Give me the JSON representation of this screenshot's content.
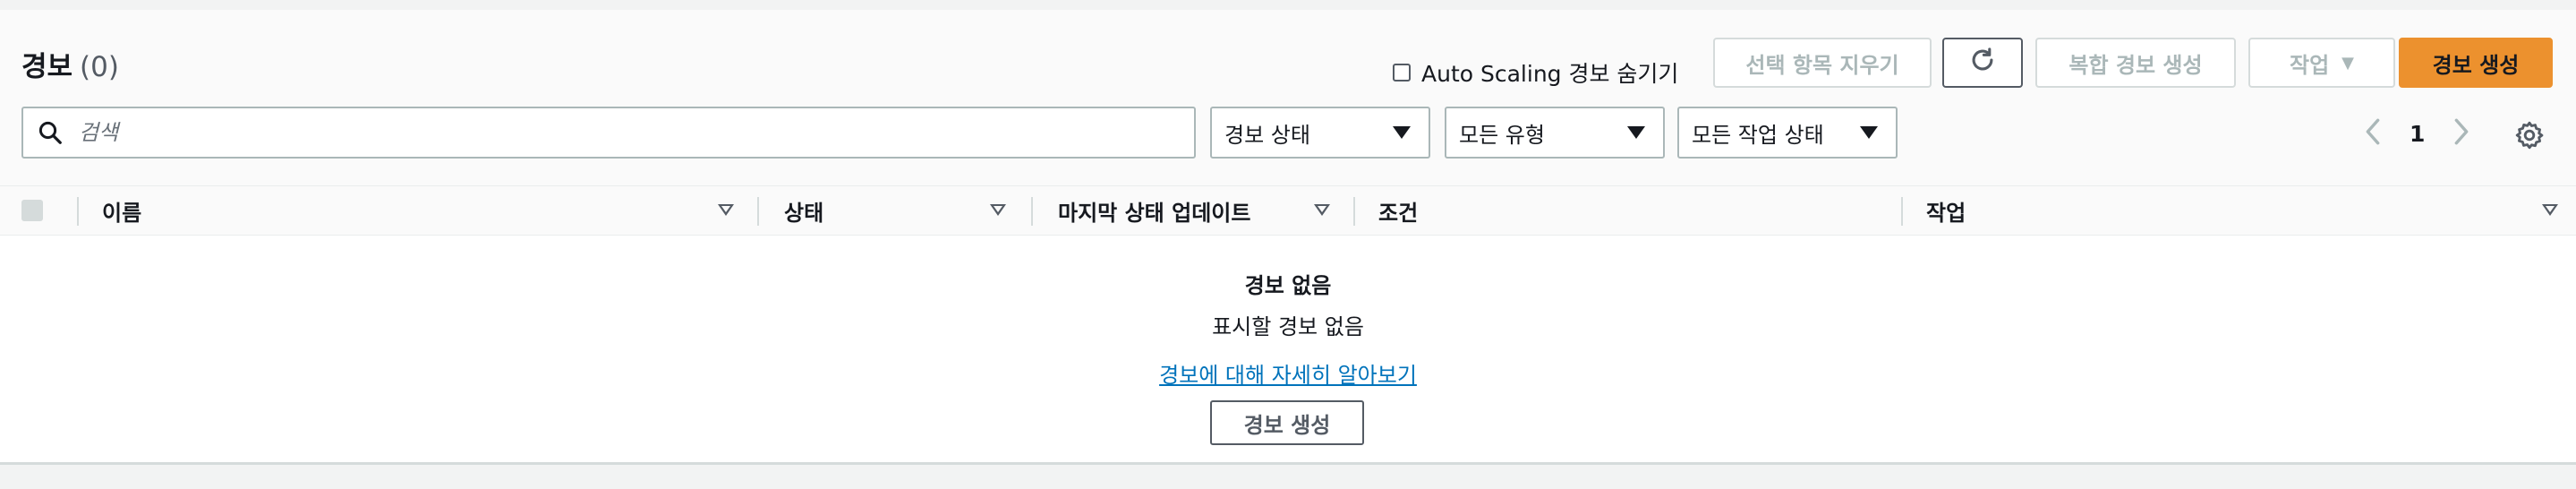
{
  "header": {
    "title": "경보",
    "count": "(0)",
    "hide_autoscaling_label": "Auto Scaling 경보 숨기기"
  },
  "toolbar": {
    "clear_selection_label": "선택 항목 지우기",
    "refresh_icon": "refresh-icon",
    "create_composite_label": "복합 경보 생성",
    "actions_label": "작업",
    "create_alarm_label": "경보 생성"
  },
  "filters": {
    "search_placeholder": "검색",
    "alarm_state": "경보 상태",
    "all_types": "모든 유형",
    "all_action_states": "모든 작업 상태"
  },
  "pagination": {
    "current_page": "1"
  },
  "table": {
    "columns": [
      {
        "label": "이름"
      },
      {
        "label": "상태"
      },
      {
        "label": "마지막 상태 업데이트"
      },
      {
        "label": "조건"
      },
      {
        "label": "작업"
      }
    ]
  },
  "empty_state": {
    "title": "경보 없음",
    "subtitle": "표시할 경보 없음",
    "learn_more_link": "경보에 대해 자세히 알아보기",
    "create_button": "경보 생성"
  },
  "colors": {
    "primary_button": "#ec912e",
    "link": "#0073bb",
    "border": "#aab7b8",
    "disabled_text": "#aab7b8"
  }
}
